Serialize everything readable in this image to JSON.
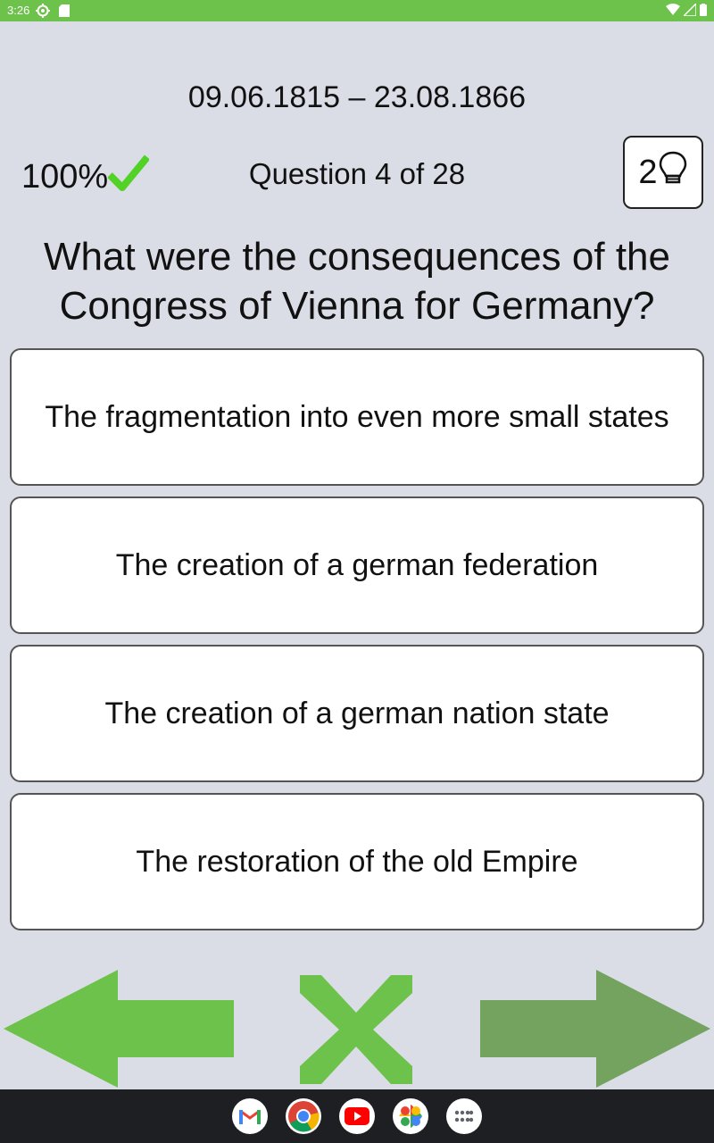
{
  "status_bar": {
    "time": "3:26"
  },
  "header": {
    "date_range": "09.06.1815 – 23.08.1866",
    "score": "100%",
    "question_counter": "Question 4 of 28",
    "hint_count": "2"
  },
  "question": {
    "text_line1": "What were the consequences of the",
    "text_line2": "Congress of Vienna for Germany?"
  },
  "answers": [
    {
      "label": "The fragmentation into even more small states"
    },
    {
      "label": "The creation of a german federation"
    },
    {
      "label": "The creation of a german nation state"
    },
    {
      "label": "The restoration of the old Empire"
    }
  ],
  "navigation": {
    "back_icon": "arrow-left-icon",
    "close_icon": "close-x-icon",
    "forward_icon": "arrow-right-icon"
  },
  "taskbar": {
    "apps": [
      "gmail-icon",
      "chrome-icon",
      "youtube-icon",
      "photos-icon",
      "app-drawer-icon"
    ]
  },
  "colors": {
    "accent_green": "#6cc24a",
    "forward_green": "#74a360",
    "background": "#dadde6"
  }
}
